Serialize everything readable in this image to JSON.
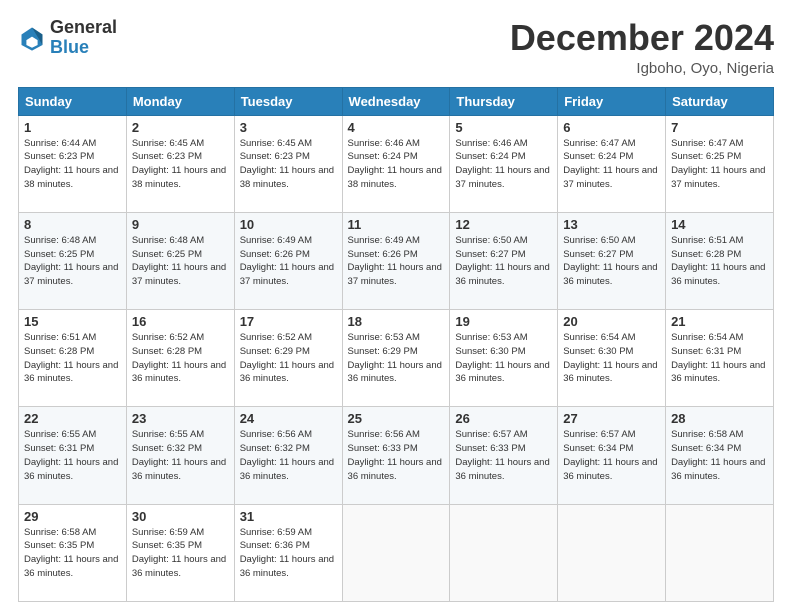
{
  "logo": {
    "general": "General",
    "blue": "Blue"
  },
  "title": "December 2024",
  "location": "Igboho, Oyo, Nigeria",
  "weekdays": [
    "Sunday",
    "Monday",
    "Tuesday",
    "Wednesday",
    "Thursday",
    "Friday",
    "Saturday"
  ],
  "weeks": [
    [
      {
        "day": "1",
        "sunrise": "6:44 AM",
        "sunset": "6:23 PM",
        "daylight": "11 hours and 38 minutes."
      },
      {
        "day": "2",
        "sunrise": "6:45 AM",
        "sunset": "6:23 PM",
        "daylight": "11 hours and 38 minutes."
      },
      {
        "day": "3",
        "sunrise": "6:45 AM",
        "sunset": "6:23 PM",
        "daylight": "11 hours and 38 minutes."
      },
      {
        "day": "4",
        "sunrise": "6:46 AM",
        "sunset": "6:24 PM",
        "daylight": "11 hours and 38 minutes."
      },
      {
        "day": "5",
        "sunrise": "6:46 AM",
        "sunset": "6:24 PM",
        "daylight": "11 hours and 37 minutes."
      },
      {
        "day": "6",
        "sunrise": "6:47 AM",
        "sunset": "6:24 PM",
        "daylight": "11 hours and 37 minutes."
      },
      {
        "day": "7",
        "sunrise": "6:47 AM",
        "sunset": "6:25 PM",
        "daylight": "11 hours and 37 minutes."
      }
    ],
    [
      {
        "day": "8",
        "sunrise": "6:48 AM",
        "sunset": "6:25 PM",
        "daylight": "11 hours and 37 minutes."
      },
      {
        "day": "9",
        "sunrise": "6:48 AM",
        "sunset": "6:25 PM",
        "daylight": "11 hours and 37 minutes."
      },
      {
        "day": "10",
        "sunrise": "6:49 AM",
        "sunset": "6:26 PM",
        "daylight": "11 hours and 37 minutes."
      },
      {
        "day": "11",
        "sunrise": "6:49 AM",
        "sunset": "6:26 PM",
        "daylight": "11 hours and 37 minutes."
      },
      {
        "day": "12",
        "sunrise": "6:50 AM",
        "sunset": "6:27 PM",
        "daylight": "11 hours and 36 minutes."
      },
      {
        "day": "13",
        "sunrise": "6:50 AM",
        "sunset": "6:27 PM",
        "daylight": "11 hours and 36 minutes."
      },
      {
        "day": "14",
        "sunrise": "6:51 AM",
        "sunset": "6:28 PM",
        "daylight": "11 hours and 36 minutes."
      }
    ],
    [
      {
        "day": "15",
        "sunrise": "6:51 AM",
        "sunset": "6:28 PM",
        "daylight": "11 hours and 36 minutes."
      },
      {
        "day": "16",
        "sunrise": "6:52 AM",
        "sunset": "6:28 PM",
        "daylight": "11 hours and 36 minutes."
      },
      {
        "day": "17",
        "sunrise": "6:52 AM",
        "sunset": "6:29 PM",
        "daylight": "11 hours and 36 minutes."
      },
      {
        "day": "18",
        "sunrise": "6:53 AM",
        "sunset": "6:29 PM",
        "daylight": "11 hours and 36 minutes."
      },
      {
        "day": "19",
        "sunrise": "6:53 AM",
        "sunset": "6:30 PM",
        "daylight": "11 hours and 36 minutes."
      },
      {
        "day": "20",
        "sunrise": "6:54 AM",
        "sunset": "6:30 PM",
        "daylight": "11 hours and 36 minutes."
      },
      {
        "day": "21",
        "sunrise": "6:54 AM",
        "sunset": "6:31 PM",
        "daylight": "11 hours and 36 minutes."
      }
    ],
    [
      {
        "day": "22",
        "sunrise": "6:55 AM",
        "sunset": "6:31 PM",
        "daylight": "11 hours and 36 minutes."
      },
      {
        "day": "23",
        "sunrise": "6:55 AM",
        "sunset": "6:32 PM",
        "daylight": "11 hours and 36 minutes."
      },
      {
        "day": "24",
        "sunrise": "6:56 AM",
        "sunset": "6:32 PM",
        "daylight": "11 hours and 36 minutes."
      },
      {
        "day": "25",
        "sunrise": "6:56 AM",
        "sunset": "6:33 PM",
        "daylight": "11 hours and 36 minutes."
      },
      {
        "day": "26",
        "sunrise": "6:57 AM",
        "sunset": "6:33 PM",
        "daylight": "11 hours and 36 minutes."
      },
      {
        "day": "27",
        "sunrise": "6:57 AM",
        "sunset": "6:34 PM",
        "daylight": "11 hours and 36 minutes."
      },
      {
        "day": "28",
        "sunrise": "6:58 AM",
        "sunset": "6:34 PM",
        "daylight": "11 hours and 36 minutes."
      }
    ],
    [
      {
        "day": "29",
        "sunrise": "6:58 AM",
        "sunset": "6:35 PM",
        "daylight": "11 hours and 36 minutes."
      },
      {
        "day": "30",
        "sunrise": "6:59 AM",
        "sunset": "6:35 PM",
        "daylight": "11 hours and 36 minutes."
      },
      {
        "day": "31",
        "sunrise": "6:59 AM",
        "sunset": "6:36 PM",
        "daylight": "11 hours and 36 minutes."
      },
      null,
      null,
      null,
      null
    ]
  ]
}
